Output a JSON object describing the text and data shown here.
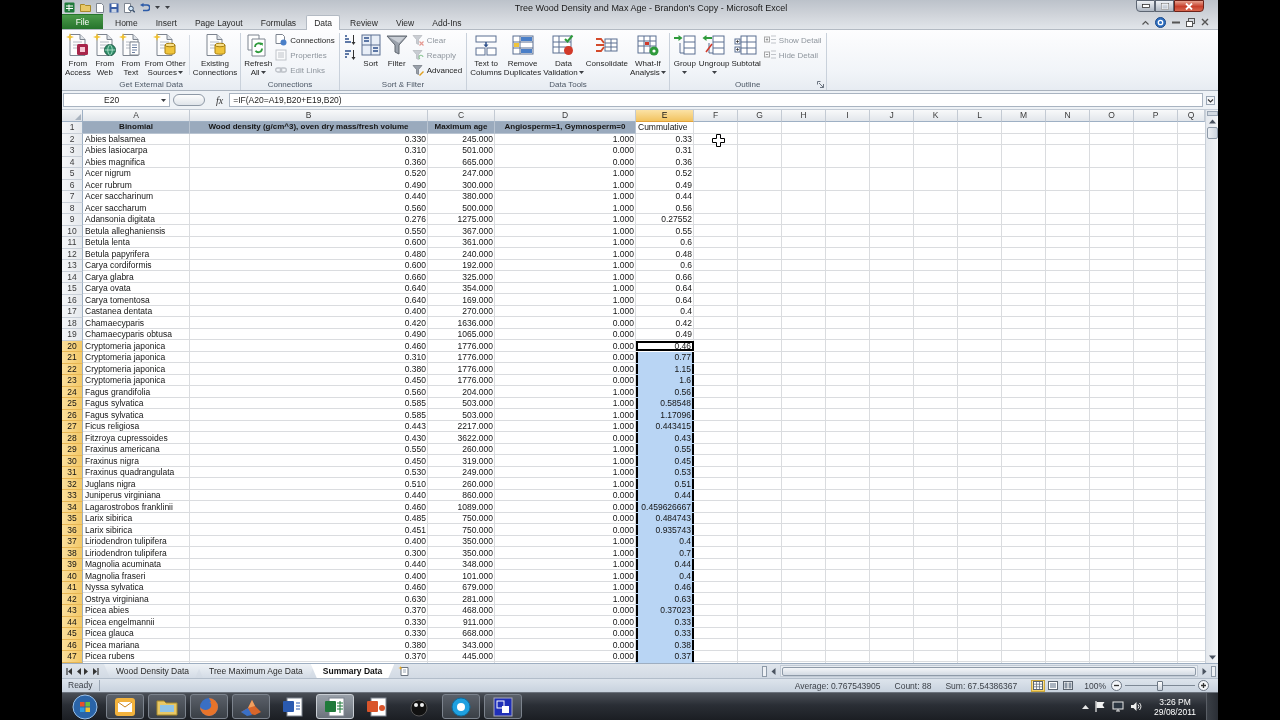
{
  "window": {
    "title": "Tree Wood Density and Max Age - Brandon's Copy - Microsoft Excel"
  },
  "ribbon": {
    "tabs": [
      {
        "label": "File",
        "kind": "file",
        "selected": false
      },
      {
        "label": "Home",
        "kind": "tab",
        "selected": false
      },
      {
        "label": "Insert",
        "kind": "tab",
        "selected": false
      },
      {
        "label": "Page Layout",
        "kind": "tab",
        "selected": false
      },
      {
        "label": "Formulas",
        "kind": "tab",
        "selected": false
      },
      {
        "label": "Data",
        "kind": "tab",
        "selected": true
      },
      {
        "label": "Review",
        "kind": "tab",
        "selected": false
      },
      {
        "label": "View",
        "kind": "tab",
        "selected": false
      },
      {
        "label": "Add-Ins",
        "kind": "tab",
        "selected": false
      }
    ],
    "groups": [
      {
        "label": "Get External Data",
        "dialog_launcher": false,
        "buttons": [
          {
            "label": "From\nAccess",
            "kind": "large",
            "dropdown": false,
            "disabled": false
          },
          {
            "label": "From\nWeb",
            "kind": "large",
            "dropdown": false,
            "disabled": false
          },
          {
            "label": "From\nText",
            "kind": "large",
            "dropdown": false,
            "disabled": false
          },
          {
            "label": "From Other\nSources",
            "kind": "large",
            "dropdown": true,
            "disabled": false
          },
          {
            "label": "Existing\nConnections",
            "kind": "large",
            "dropdown": false,
            "disabled": false
          }
        ]
      },
      {
        "label": "Connections",
        "dialog_launcher": false,
        "buttons": [
          {
            "label": "Refresh\nAll",
            "kind": "large",
            "dropdown": true,
            "disabled": false
          },
          {
            "label": "Connections",
            "kind": "small",
            "dropdown": false,
            "disabled": false
          },
          {
            "label": "Properties",
            "kind": "small",
            "dropdown": false,
            "disabled": true
          },
          {
            "label": "Edit Links",
            "kind": "small",
            "dropdown": false,
            "disabled": true
          }
        ]
      },
      {
        "label": "Sort & Filter",
        "dialog_launcher": false,
        "buttons": [
          {
            "kind": "icon",
            "dropdown": false,
            "disabled": false
          },
          {
            "kind": "icon",
            "dropdown": false,
            "disabled": false
          },
          {
            "label": "Sort",
            "kind": "large",
            "dropdown": false,
            "disabled": false
          },
          {
            "label": "Filter",
            "kind": "large",
            "dropdown": false,
            "disabled": false
          },
          {
            "label": "Clear",
            "kind": "small",
            "dropdown": false,
            "disabled": true
          },
          {
            "label": "Reapply",
            "kind": "small",
            "dropdown": false,
            "disabled": true
          },
          {
            "label": "Advanced",
            "kind": "small",
            "dropdown": false,
            "disabled": false
          }
        ]
      },
      {
        "label": "Data Tools",
        "dialog_launcher": false,
        "buttons": [
          {
            "label": "Text to\nColumns",
            "kind": "large",
            "dropdown": false,
            "disabled": false
          },
          {
            "label": "Remove\nDuplicates",
            "kind": "large",
            "dropdown": false,
            "disabled": false
          },
          {
            "label": "Data\nValidation",
            "kind": "large",
            "dropdown": true,
            "disabled": false
          },
          {
            "label": "Consolidate",
            "kind": "large",
            "dropdown": false,
            "disabled": false
          },
          {
            "label": "What-If\nAnalysis",
            "kind": "large",
            "dropdown": true,
            "disabled": false
          }
        ]
      },
      {
        "label": "Outline",
        "dialog_launcher": true,
        "buttons": [
          {
            "label": "Group",
            "kind": "large",
            "dropdown": true,
            "disabled": false
          },
          {
            "label": "Ungroup",
            "kind": "large",
            "dropdown": true,
            "disabled": false
          },
          {
            "label": "Subtotal",
            "kind": "large",
            "dropdown": false,
            "disabled": false
          },
          {
            "label": "Show Detail",
            "kind": "small",
            "dropdown": false,
            "disabled": true
          },
          {
            "label": "Hide Detail",
            "kind": "small",
            "dropdown": false,
            "disabled": true
          }
        ]
      }
    ]
  },
  "formula_bar": {
    "name_box": "E20",
    "function_button": "fx",
    "formula": "=IF(A20=A19,B20+E19,B20)"
  },
  "sheet": {
    "columns": [
      {
        "label": "A",
        "selected": false
      },
      {
        "label": "B",
        "selected": false
      },
      {
        "label": "C",
        "selected": false
      },
      {
        "label": "D",
        "selected": false
      },
      {
        "label": "E",
        "selected": true
      },
      {
        "label": "F",
        "selected": false
      },
      {
        "label": "G",
        "selected": false
      },
      {
        "label": "H",
        "selected": false
      },
      {
        "label": "I",
        "selected": false
      },
      {
        "label": "J",
        "selected": false
      },
      {
        "label": "K",
        "selected": false
      },
      {
        "label": "L",
        "selected": false
      },
      {
        "label": "M",
        "selected": false
      },
      {
        "label": "N",
        "selected": false
      },
      {
        "label": "O",
        "selected": false
      },
      {
        "label": "P",
        "selected": false
      },
      {
        "label": "Q",
        "selected": false
      }
    ],
    "rows": [
      {
        "number": "1",
        "kind": "header",
        "selected": false,
        "active": false,
        "cells": [
          "Binomial",
          "Wood density (g/cm^3), oven dry mass/fresh volume",
          "Maximum age",
          "Angiosperm=1, Gymnosperm=0",
          "Cummulative"
        ]
      },
      {
        "number": "2",
        "kind": "data",
        "selected": false,
        "active": false,
        "cells": [
          "Abies balsamea",
          "0.330",
          "245.000",
          "1.000",
          "0.33"
        ]
      },
      {
        "number": "3",
        "kind": "data",
        "selected": false,
        "active": false,
        "cells": [
          "Abies lasiocarpa",
          "0.310",
          "501.000",
          "0.000",
          "0.31"
        ]
      },
      {
        "number": "4",
        "kind": "data",
        "selected": false,
        "active": false,
        "cells": [
          "Abies magnifica",
          "0.360",
          "665.000",
          "0.000",
          "0.36"
        ]
      },
      {
        "number": "5",
        "kind": "data",
        "selected": false,
        "active": false,
        "cells": [
          "Acer nigrum",
          "0.520",
          "247.000",
          "1.000",
          "0.52"
        ]
      },
      {
        "number": "6",
        "kind": "data",
        "selected": false,
        "active": false,
        "cells": [
          "Acer rubrum",
          "0.490",
          "300.000",
          "1.000",
          "0.49"
        ]
      },
      {
        "number": "7",
        "kind": "data",
        "selected": false,
        "active": false,
        "cells": [
          "Acer saccharinum",
          "0.440",
          "380.000",
          "1.000",
          "0.44"
        ]
      },
      {
        "number": "8",
        "kind": "data",
        "selected": false,
        "active": false,
        "cells": [
          "Acer saccharum",
          "0.560",
          "500.000",
          "1.000",
          "0.56"
        ]
      },
      {
        "number": "9",
        "kind": "data",
        "selected": false,
        "active": false,
        "cells": [
          "Adansonia digitata",
          "0.276",
          "1275.000",
          "1.000",
          "0.27552"
        ]
      },
      {
        "number": "10",
        "kind": "data",
        "selected": false,
        "active": false,
        "cells": [
          "Betula alleghaniensis",
          "0.550",
          "367.000",
          "1.000",
          "0.55"
        ]
      },
      {
        "number": "11",
        "kind": "data",
        "selected": false,
        "active": false,
        "cells": [
          "Betula lenta",
          "0.600",
          "361.000",
          "1.000",
          "0.6"
        ]
      },
      {
        "number": "12",
        "kind": "data",
        "selected": false,
        "active": false,
        "cells": [
          "Betula papyrifera",
          "0.480",
          "240.000",
          "1.000",
          "0.48"
        ]
      },
      {
        "number": "13",
        "kind": "data",
        "selected": false,
        "active": false,
        "cells": [
          "Carya cordiformis",
          "0.600",
          "192.000",
          "1.000",
          "0.6"
        ]
      },
      {
        "number": "14",
        "kind": "data",
        "selected": false,
        "active": false,
        "cells": [
          "Carya glabra",
          "0.660",
          "325.000",
          "1.000",
          "0.66"
        ]
      },
      {
        "number": "15",
        "kind": "data",
        "selected": false,
        "active": false,
        "cells": [
          "Carya ovata",
          "0.640",
          "354.000",
          "1.000",
          "0.64"
        ]
      },
      {
        "number": "16",
        "kind": "data",
        "selected": false,
        "active": false,
        "cells": [
          "Carya tomentosa",
          "0.640",
          "169.000",
          "1.000",
          "0.64"
        ]
      },
      {
        "number": "17",
        "kind": "data",
        "selected": false,
        "active": false,
        "cells": [
          "Castanea dentata",
          "0.400",
          "270.000",
          "1.000",
          "0.4"
        ]
      },
      {
        "number": "18",
        "kind": "data",
        "selected": false,
        "active": false,
        "cells": [
          "Chamaecyparis",
          "0.420",
          "1636.000",
          "0.000",
          "0.42"
        ]
      },
      {
        "number": "19",
        "kind": "data",
        "selected": false,
        "active": false,
        "cells": [
          "Chamaecyparis obtusa",
          "0.490",
          "1065.000",
          "0.000",
          "0.49"
        ]
      },
      {
        "number": "20",
        "kind": "data",
        "selected": true,
        "active": true,
        "cells": [
          "Cryptomeria japonica",
          "0.460",
          "1776.000",
          "0.000",
          "0.46"
        ]
      },
      {
        "number": "21",
        "kind": "data",
        "selected": true,
        "active": false,
        "cells": [
          "Cryptomeria japonica",
          "0.310",
          "1776.000",
          "0.000",
          "0.77"
        ]
      },
      {
        "number": "22",
        "kind": "data",
        "selected": true,
        "active": false,
        "cells": [
          "Cryptomeria japonica",
          "0.380",
          "1776.000",
          "0.000",
          "1.15"
        ]
      },
      {
        "number": "23",
        "kind": "data",
        "selected": true,
        "active": false,
        "cells": [
          "Cryptomeria japonica",
          "0.450",
          "1776.000",
          "0.000",
          "1.6"
        ]
      },
      {
        "number": "24",
        "kind": "data",
        "selected": true,
        "active": false,
        "cells": [
          "Fagus grandifolia",
          "0.560",
          "204.000",
          "1.000",
          "0.56"
        ]
      },
      {
        "number": "25",
        "kind": "data",
        "selected": true,
        "active": false,
        "cells": [
          "Fagus sylvatica",
          "0.585",
          "503.000",
          "1.000",
          "0.58548"
        ]
      },
      {
        "number": "26",
        "kind": "data",
        "selected": true,
        "active": false,
        "cells": [
          "Fagus sylvatica",
          "0.585",
          "503.000",
          "1.000",
          "1.17096"
        ]
      },
      {
        "number": "27",
        "kind": "data",
        "selected": true,
        "active": false,
        "cells": [
          "Ficus religiosa",
          "0.443",
          "2217.000",
          "1.000",
          "0.443415"
        ]
      },
      {
        "number": "28",
        "kind": "data",
        "selected": true,
        "active": false,
        "cells": [
          "Fitzroya cupressoides",
          "0.430",
          "3622.000",
          "0.000",
          "0.43"
        ]
      },
      {
        "number": "29",
        "kind": "data",
        "selected": true,
        "active": false,
        "cells": [
          "Fraxinus americana",
          "0.550",
          "260.000",
          "1.000",
          "0.55"
        ]
      },
      {
        "number": "30",
        "kind": "data",
        "selected": true,
        "active": false,
        "cells": [
          "Fraxinus nigra",
          "0.450",
          "319.000",
          "1.000",
          "0.45"
        ]
      },
      {
        "number": "31",
        "kind": "data",
        "selected": true,
        "active": false,
        "cells": [
          "Fraxinus quadrangulata",
          "0.530",
          "249.000",
          "1.000",
          "0.53"
        ]
      },
      {
        "number": "32",
        "kind": "data",
        "selected": true,
        "active": false,
        "cells": [
          "Juglans nigra",
          "0.510",
          "260.000",
          "1.000",
          "0.51"
        ]
      },
      {
        "number": "33",
        "kind": "data",
        "selected": true,
        "active": false,
        "cells": [
          "Juniperus virginiana",
          "0.440",
          "860.000",
          "0.000",
          "0.44"
        ]
      },
      {
        "number": "34",
        "kind": "data",
        "selected": true,
        "active": false,
        "cells": [
          "Lagarostrobos franklinii",
          "0.460",
          "1089.000",
          "0.000",
          "0.459626667"
        ]
      },
      {
        "number": "35",
        "kind": "data",
        "selected": true,
        "active": false,
        "cells": [
          "Larix sibirica",
          "0.485",
          "750.000",
          "0.000",
          "0.484743"
        ]
      },
      {
        "number": "36",
        "kind": "data",
        "selected": true,
        "active": false,
        "cells": [
          "Larix sibirica",
          "0.451",
          "750.000",
          "0.000",
          "0.935743"
        ]
      },
      {
        "number": "37",
        "kind": "data",
        "selected": true,
        "active": false,
        "cells": [
          "Liriodendron tulipifera",
          "0.400",
          "350.000",
          "1.000",
          "0.4"
        ]
      },
      {
        "number": "38",
        "kind": "data",
        "selected": true,
        "active": false,
        "cells": [
          "Liriodendron tulipifera",
          "0.300",
          "350.000",
          "1.000",
          "0.7"
        ]
      },
      {
        "number": "39",
        "kind": "data",
        "selected": true,
        "active": false,
        "cells": [
          "Magnolia acuminata",
          "0.440",
          "348.000",
          "1.000",
          "0.44"
        ]
      },
      {
        "number": "40",
        "kind": "data",
        "selected": true,
        "active": false,
        "cells": [
          "Magnolia fraseri",
          "0.400",
          "101.000",
          "1.000",
          "0.4"
        ]
      },
      {
        "number": "41",
        "kind": "data",
        "selected": true,
        "active": false,
        "cells": [
          "Nyssa sylvatica",
          "0.460",
          "679.000",
          "1.000",
          "0.46"
        ]
      },
      {
        "number": "42",
        "kind": "data",
        "selected": true,
        "active": false,
        "cells": [
          "Ostrya virginiana",
          "0.630",
          "281.000",
          "1.000",
          "0.63"
        ]
      },
      {
        "number": "43",
        "kind": "data",
        "selected": true,
        "active": false,
        "cells": [
          "Picea abies",
          "0.370",
          "468.000",
          "0.000",
          "0.37023"
        ]
      },
      {
        "number": "44",
        "kind": "data",
        "selected": true,
        "active": false,
        "cells": [
          "Picea engelmannii",
          "0.330",
          "911.000",
          "0.000",
          "0.33"
        ]
      },
      {
        "number": "45",
        "kind": "data",
        "selected": true,
        "active": false,
        "cells": [
          "Picea glauca",
          "0.330",
          "668.000",
          "0.000",
          "0.33"
        ]
      },
      {
        "number": "46",
        "kind": "data",
        "selected": true,
        "active": false,
        "cells": [
          "Picea mariana",
          "0.380",
          "343.000",
          "0.000",
          "0.38"
        ]
      },
      {
        "number": "47",
        "kind": "data",
        "selected": true,
        "active": false,
        "cells": [
          "Picea rubens",
          "0.370",
          "445.000",
          "0.000",
          "0.37"
        ]
      }
    ]
  },
  "sheet_tabs": [
    {
      "label": "Wood Density Data",
      "selected": false
    },
    {
      "label": "Tree Maximum Age Data",
      "selected": false
    },
    {
      "label": "Summary Data",
      "selected": true
    }
  ],
  "status_bar": {
    "mode": "Ready",
    "stats": [
      "Average: 0.767543905",
      "Count: 88",
      "Sum: 67.54386367"
    ],
    "views": [
      {
        "kind": "normal",
        "selected": true
      },
      {
        "kind": "page_layout",
        "selected": false
      },
      {
        "kind": "page_break",
        "selected": false
      }
    ],
    "zoom": {
      "label": "100%",
      "level": 0.5
    }
  },
  "taskbar": {
    "buttons": [
      {
        "running": true,
        "selected": false
      },
      {
        "running": true,
        "selected": false
      },
      {
        "running": true,
        "selected": false
      },
      {
        "running": true,
        "selected": false
      },
      {
        "running": false,
        "selected": false
      },
      {
        "running": true,
        "selected": true
      },
      {
        "running": false,
        "selected": false
      },
      {
        "running": false,
        "selected": false
      },
      {
        "running": true,
        "selected": false
      },
      {
        "running": true,
        "selected": false
      }
    ],
    "clock": {
      "time": "3:26 PM",
      "date": "29/08/2011"
    }
  }
}
